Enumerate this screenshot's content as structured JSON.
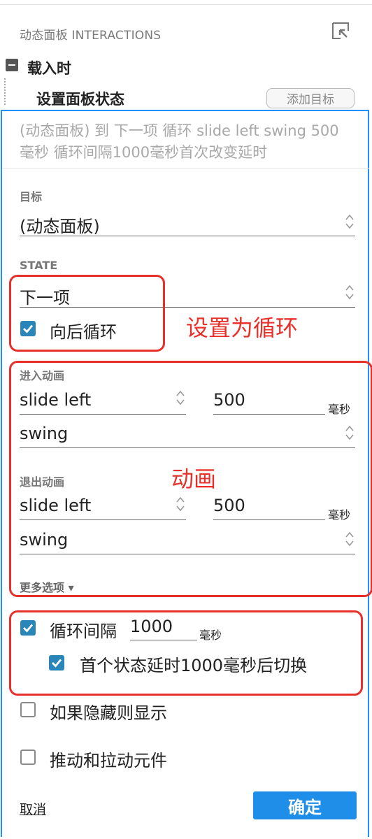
{
  "header": {
    "title": "动态面板 INTERACTIONS",
    "event_label": "载入时",
    "action_label": "设置面板状态",
    "add_target_label": "添加目标"
  },
  "summary_text": "(动态面板) 到 下一项 循环 slide left swing 500毫秒 循环间隔1000毫秒首次改变延时",
  "target": {
    "label": "目标",
    "value": "(动态面板)"
  },
  "state": {
    "label": "STATE",
    "value": "下一项",
    "loop_backward": {
      "label": "向后循环",
      "checked": true
    }
  },
  "enter_animation": {
    "label": "进入动画",
    "type": "slide left",
    "duration": "500",
    "unit": "毫秒",
    "easing": "swing"
  },
  "exit_animation": {
    "label": "退出动画",
    "type": "slide left",
    "duration": "500",
    "unit": "毫秒",
    "easing": "swing"
  },
  "more_options_label": "更多选项 ▾",
  "loop_interval": {
    "label": "循环间隔",
    "value": "1000",
    "unit": "毫秒",
    "checked": true,
    "first_delay": {
      "label": "首个状态延时1000毫秒后切换",
      "checked": true
    }
  },
  "show_if_hidden": {
    "label": "如果隐藏则显示",
    "checked": false
  },
  "push_pull": {
    "label": "推动和拉动元件",
    "checked": false
  },
  "footer": {
    "cancel_label": "取消",
    "confirm_label": "确定"
  },
  "annotations": {
    "loop_note": "设置为循环",
    "animation_note": "动画"
  },
  "colors": {
    "accent_blue": "#1e8ee8",
    "checkbox_blue": "#2a86b8",
    "annotation_red": "#e8302a"
  }
}
